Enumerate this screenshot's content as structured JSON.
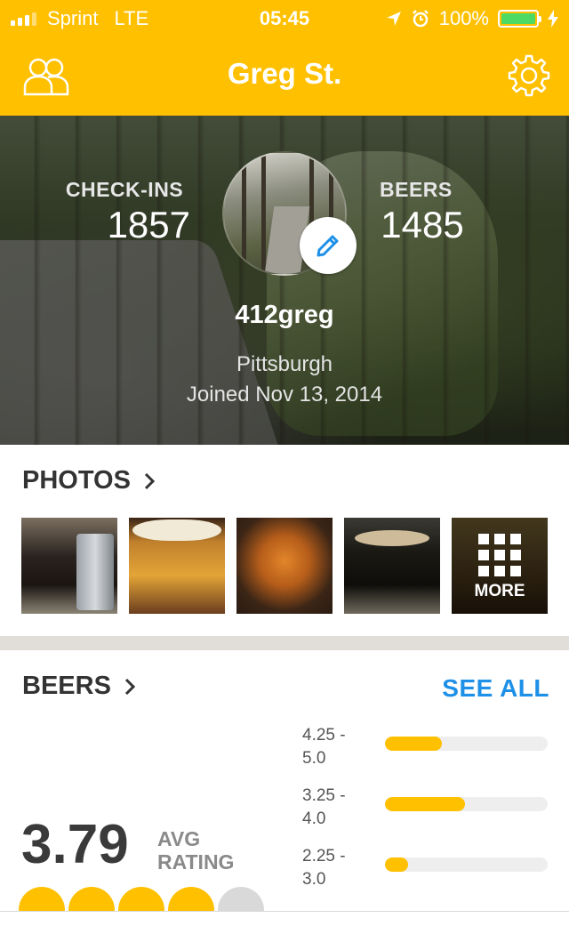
{
  "status_bar": {
    "carrier": "Sprint",
    "network": "LTE",
    "time": "05:45",
    "battery": "100%"
  },
  "nav": {
    "title": "Greg St.",
    "left_icon": "friends-icon",
    "right_icon": "gear-icon"
  },
  "profile": {
    "checkins_label": "CHECK-INS",
    "checkins_value": "1857",
    "beers_label": "BEERS",
    "beers_value": "1485",
    "username": "412greg",
    "location": "Pittsburgh",
    "joined": "Joined Nov 13, 2014"
  },
  "photos": {
    "title": "PHOTOS",
    "more_label": "MORE",
    "items": [
      "beer-photo-1",
      "beer-photo-2",
      "beer-photo-3",
      "beer-photo-4"
    ]
  },
  "beers": {
    "title": "BEERS",
    "see_all": "SEE ALL",
    "avg_rating": "3.79",
    "avg_label_1": "AVG",
    "avg_label_2": "RATING",
    "rating_caps": {
      "filled": 4,
      "total": 5
    },
    "distribution": [
      {
        "range_line1": "4.25 -",
        "range_line2": "5.0",
        "fraction": 0.35
      },
      {
        "range_line1": "3.25 -",
        "range_line2": "4.0",
        "fraction": 0.49
      },
      {
        "range_line1": "2.25 -",
        "range_line2": "3.0",
        "fraction": 0.14
      }
    ]
  },
  "colors": {
    "brand": "#FFC000",
    "link": "#1E90E8",
    "text_dark": "#333333"
  }
}
